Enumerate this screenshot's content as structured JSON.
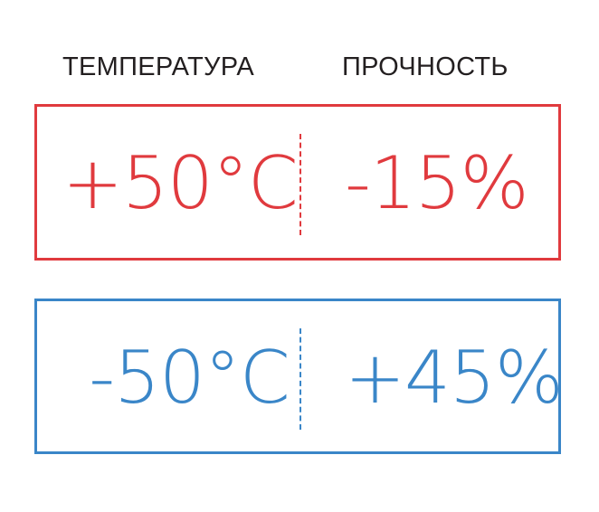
{
  "headers": {
    "temperature": "ТЕМПЕРАТУРА",
    "strength": "ПРОЧНОСТЬ"
  },
  "rows": [
    {
      "temperature": "+50°C",
      "strength": "-15%",
      "color": "#e03a3e"
    },
    {
      "temperature": "-50°C",
      "strength": "+45%",
      "color": "#3a86c8"
    }
  ],
  "colors": {
    "header_text": "#231f20",
    "hot": "#e03a3e",
    "cold": "#3a86c8"
  }
}
